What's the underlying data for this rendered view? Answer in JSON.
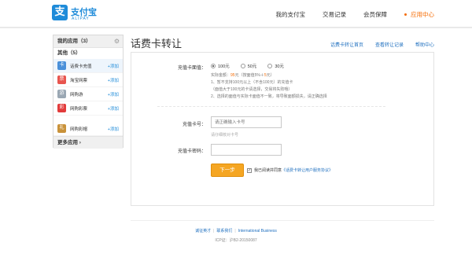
{
  "header": {
    "logo_glyph": "支",
    "logo_cn": "支付宝",
    "logo_en": "ALIPAY",
    "nav": [
      "我的支付宝",
      "交易记录",
      "会员保障",
      "应用中心"
    ],
    "active_index": 3,
    "brand_color": "#1e8bd9",
    "accent_color": "#f56a00"
  },
  "sidebar": {
    "title": "我的应用（3）",
    "gear_icon": "gear-icon",
    "section": "其他（5）",
    "items": [
      {
        "label": "话费卡充值",
        "add": "+添加",
        "icon": "phone-card-icon",
        "color": "#4a90d9",
        "glyph": "卡"
      },
      {
        "label": "淘宝网票",
        "add": "+添加",
        "icon": "ticket-icon",
        "color": "#e8554e",
        "glyph": "票"
      },
      {
        "label": "网购游",
        "add": "+添加",
        "icon": "travel-icon",
        "color": "#9aa7b3",
        "glyph": "游"
      },
      {
        "label": "网购彩票",
        "add": "+添加",
        "icon": "lottery-icon",
        "color": "#e23b3b",
        "glyph": "彩"
      },
      {
        "label": "网购彩帽",
        "add": "+添加",
        "icon": "gift-icon",
        "color": "#c9923a",
        "glyph": "礼"
      }
    ],
    "more": "更多应用 ›"
  },
  "main": {
    "title": "话费卡转让",
    "links": [
      "话费卡转让首页",
      "查看转让记录",
      "帮助中心"
    ],
    "denomination_label": "充值卡面值：",
    "options": [
      "100元",
      "50元",
      "30元"
    ],
    "selected_option": 0,
    "note1_pre": "实际金额：",
    "note1_amount": "95",
    "note1_mid": "元（按面值5%＋",
    "note1_fee": "5",
    "note1_post": "元）",
    "note2": "1、暂不支持100元以上（不含100元）的充值卡",
    "note3": "（面值大于100元的卡请选择，交易将失败哦）",
    "note4": "2、选择的面值与实际卡面值不一致，将导致面额损失，请正确选择",
    "card_no_label": "充值卡号：",
    "card_no_placeholder": "请正确输入卡号",
    "card_no_hint": "请仔细核对卡号",
    "card_pwd_label": "充值卡密码：",
    "submit": "下一步",
    "agree_text": "我已阅读并同意",
    "agree_link": "《话费卡转让用户服务协议》"
  },
  "footer": {
    "links": [
      "诚征英才",
      "联系我们",
      "International Business"
    ],
    "icp": "ICP证：沪B2-20150087"
  }
}
